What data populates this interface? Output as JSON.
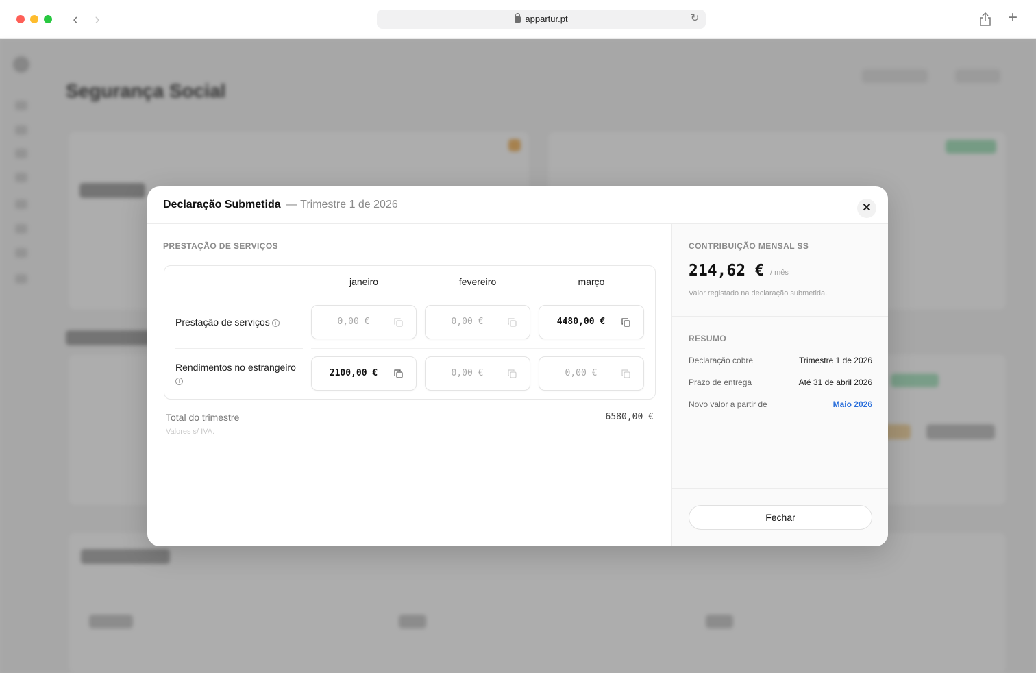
{
  "browser": {
    "url": "appartur.pt"
  },
  "background": {
    "page_title": "Segurança Social"
  },
  "modal": {
    "title": "Declaração Submetida",
    "subtitle": "— Trimestre 1 de 2026",
    "close_icon": "close-icon",
    "section_label": "PRESTAÇÃO DE SERVIÇOS",
    "months": [
      "janeiro",
      "fevereiro",
      "março"
    ],
    "rows": [
      {
        "label": "Prestação de serviços",
        "values": [
          "0,00 €",
          "0,00 €",
          "4480,00 €"
        ],
        "filled": [
          false,
          false,
          true
        ]
      },
      {
        "label": "Rendimentos no estrangeiro",
        "values": [
          "2100,00 €",
          "0,00 €",
          "0,00 €"
        ],
        "filled": [
          true,
          false,
          false
        ]
      }
    ],
    "total_label": "Total do trimestre",
    "total_value": "6580,00 €",
    "vat_note": "Valores s/ IVA.",
    "contribution": {
      "label": "CONTRIBUIÇÃO MENSAL SS",
      "amount": "214,62 €",
      "per_month": "/ mês",
      "note": "Valor registado na declaração submetida."
    },
    "summary": {
      "label": "RESUMO",
      "items": [
        {
          "label": "Declaração cobre",
          "value": "Trimestre 1 de 2026"
        },
        {
          "label": "Prazo de entrega",
          "value": "Até 31 de abril 2026"
        },
        {
          "label": "Novo valor a partir de",
          "value": "Maio 2026"
        }
      ]
    },
    "close_button": "Fechar"
  },
  "colors": {
    "accent_link": "#2a6fdb",
    "muted_text": "#8a8a8a"
  }
}
